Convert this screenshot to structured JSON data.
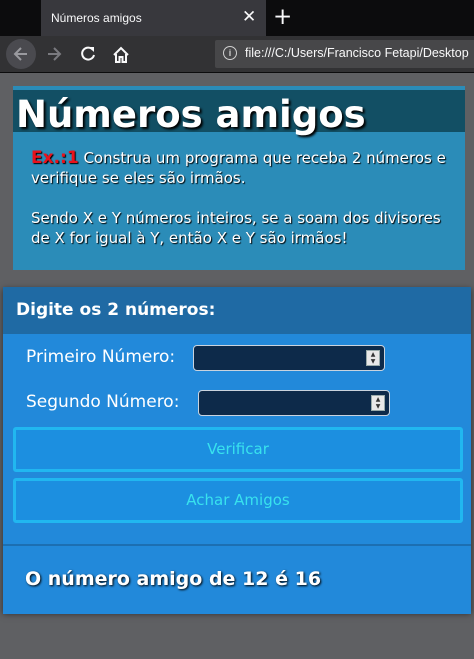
{
  "browser": {
    "tab_title": "Números amigos",
    "tab_close": "✕",
    "new_tab": "+",
    "url": "file:///C:/Users/Francisco Fetapi/Desktop",
    "icons": [
      "back-arrow-icon",
      "forward-arrow-icon",
      "reload-icon",
      "home-icon",
      "info-icon"
    ]
  },
  "header": {
    "title": "Números amigos",
    "exercise_label": "Ex.:1",
    "paragraph1": " Construa um programa que receba 2 números e verifique se eles são irmãos.",
    "paragraph2": "Sendo X e Y números inteiros, se a soam dos divisores de X for igual à Y, então X e Y são irmãos!"
  },
  "form": {
    "title": "Digite os 2 números:",
    "first_label": "Primeiro Número:",
    "first_value": "",
    "second_label": "Segundo Número:",
    "second_value": "",
    "verify_button": "Verificar",
    "find_button": "Achar Amigos"
  },
  "result": {
    "text": "O número amigo de 12 é 16"
  },
  "colors": {
    "page_bg": "#5f6063",
    "header_bg": "#2b8cb8",
    "title_bar_bg": "#124f64",
    "panel_bg": "#2289da",
    "panel_header_bg": "#1f6aa4",
    "button_border": "#21b7f0",
    "button_text": "#38e2ee",
    "exercise_red": "#e8121c"
  }
}
